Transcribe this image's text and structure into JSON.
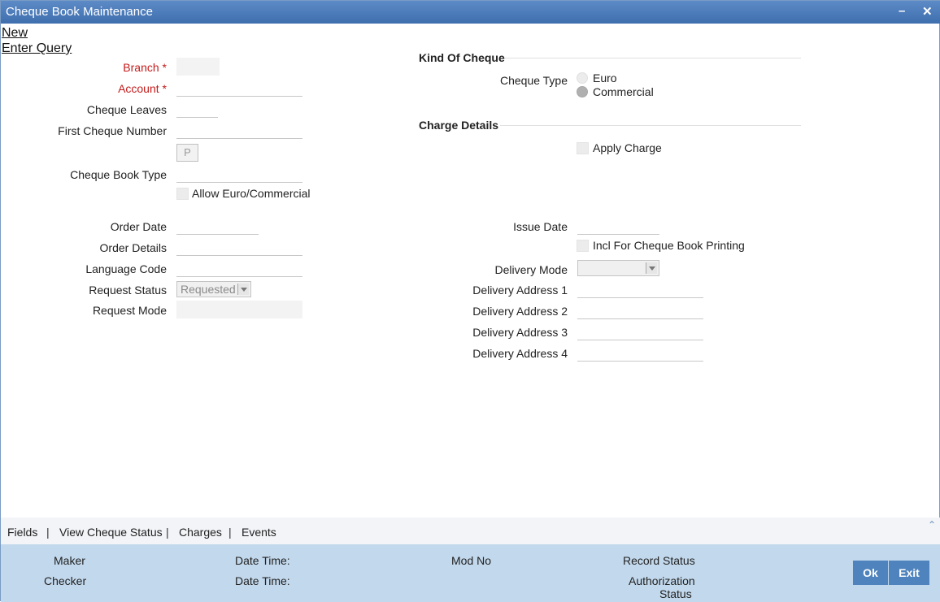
{
  "window": {
    "title": "Cheque Book Maintenance"
  },
  "menu": {
    "new": "New",
    "enter_query": "Enter Query"
  },
  "form": {
    "branch_label": "Branch",
    "account_label": "Account",
    "required_marker": "*",
    "cheque_leaves_label": "Cheque Leaves",
    "first_cheque_number_label": "First Cheque Number",
    "p_button_label": "P",
    "cheque_book_type_label": "Cheque Book Type",
    "allow_euro_label": "Allow Euro/Commercial",
    "order_date_label": "Order Date",
    "order_details_label": "Order Details",
    "language_code_label": "Language Code",
    "request_status_label": "Request Status",
    "request_status_value": "Requested",
    "request_mode_label": "Request Mode"
  },
  "kind_of_cheque": {
    "title": "Kind Of Cheque",
    "cheque_type_label": "Cheque Type",
    "options": [
      "Euro",
      "Commercial"
    ],
    "selected": "Commercial"
  },
  "charge_details": {
    "title": "Charge Details",
    "apply_charge_label": "Apply Charge"
  },
  "delivery": {
    "issue_date_label": "Issue Date",
    "incl_printing_label": "Incl For Cheque Book Printing",
    "delivery_mode_label": "Delivery Mode",
    "delivery_mode_value": "",
    "address1_label": "Delivery Address 1",
    "address2_label": "Delivery Address 2",
    "address3_label": "Delivery Address 3",
    "address4_label": "Delivery Address 4"
  },
  "tabs": {
    "fields": "Fields",
    "view_cheque_status": "View Cheque Status",
    "charges": "Charges",
    "events": "Events",
    "separator": "|"
  },
  "footer": {
    "maker": "Maker",
    "checker": "Checker",
    "date_time": "Date Time:",
    "mod_no": "Mod No",
    "record_status": "Record Status",
    "authorization": "Authorization",
    "status": "Status",
    "ok": "Ok",
    "exit": "Exit"
  }
}
